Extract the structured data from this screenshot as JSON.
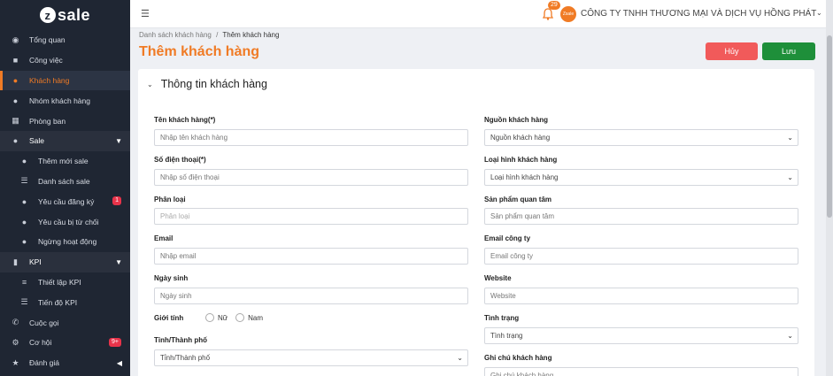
{
  "app": {
    "logo_letter": "z",
    "logo_text": "sale"
  },
  "sidebar": {
    "items": [
      {
        "label": "Tổng quan",
        "icon": "dashboard-icon"
      },
      {
        "label": "Công việc",
        "icon": "briefcase-icon"
      },
      {
        "label": "Khách hàng",
        "icon": "user-icon",
        "active": true
      },
      {
        "label": "Nhóm khách hàng",
        "icon": "users-icon"
      },
      {
        "label": "Phòng ban",
        "icon": "building-icon"
      },
      {
        "label": "Sale",
        "icon": "user-tie-icon",
        "group": true
      },
      {
        "label": "Thêm mới sale",
        "icon": "user-plus-icon",
        "sub": true
      },
      {
        "label": "Danh sách sale",
        "icon": "list-icon",
        "sub": true
      },
      {
        "label": "Yêu cầu đăng ký",
        "icon": "user-plus-icon",
        "sub": true,
        "badge": "1"
      },
      {
        "label": "Yêu cầu bị từ chối",
        "icon": "user-times-icon",
        "sub": true
      },
      {
        "label": "Ngừng hoạt động",
        "icon": "user-slash-icon",
        "sub": true
      },
      {
        "label": "KPI",
        "icon": "chart-icon",
        "group": true
      },
      {
        "label": "Thiết lập KPI",
        "icon": "sliders-icon",
        "sub": true
      },
      {
        "label": "Tiến độ KPI",
        "icon": "list-icon",
        "sub": true
      },
      {
        "label": "Cuộc gọi",
        "icon": "phone-icon"
      },
      {
        "label": "Cơ hội",
        "icon": "gear-icon",
        "badge": "9+"
      },
      {
        "label": "Đánh giá",
        "icon": "star-icon"
      }
    ]
  },
  "header": {
    "notification_count": "29",
    "company_logo_text": "Zsale",
    "company_name": "CÔNG TY TNHH THƯƠNG MẠI VÀ DỊCH VỤ HỒNG PHÁT"
  },
  "breadcrumb": {
    "parent": "Danh sách khách hàng",
    "separator": "/",
    "current": "Thêm khách hàng"
  },
  "page": {
    "title": "Thêm khách hàng",
    "cancel_label": "Hủy",
    "save_label": "Lưu"
  },
  "form": {
    "section_title": "Thông tin khách hàng",
    "left": [
      {
        "label": "Tên khách hàng(*)",
        "placeholder": "Nhập tên khách hàng"
      },
      {
        "label": "Số điện thoại(*)",
        "placeholder": "Nhập số điện thoại"
      },
      {
        "label": "Phân loại",
        "placeholder": "Phân loại"
      },
      {
        "label": "Email",
        "placeholder": "Nhập email"
      },
      {
        "label": "Ngày sinh",
        "placeholder": "Ngày sinh"
      },
      {
        "label": "Tỉnh/Thành phố",
        "placeholder": "Tỉnh/Thành phố",
        "select": true
      }
    ],
    "gender": {
      "label": "Giới tính",
      "options": [
        "Nữ",
        "Nam"
      ]
    },
    "right": [
      {
        "label": "Nguồn khách hàng",
        "placeholder": "Nguồn khách hàng",
        "select": true
      },
      {
        "label": "Loại hình khách hàng",
        "placeholder": "Loại hình khách hàng",
        "select": true
      },
      {
        "label": "Sản phẩm quan tâm",
        "placeholder": "Sản phẩm quan tâm"
      },
      {
        "label": "Email công ty",
        "placeholder": "Email công ty"
      },
      {
        "label": "Website",
        "placeholder": "Website"
      },
      {
        "label": "Tình trạng",
        "placeholder": "Tình trạng",
        "select": true
      },
      {
        "label": "Ghi chú khách hàng",
        "placeholder": "Ghi chú khách hàng"
      }
    ]
  },
  "colors": {
    "accent": "#f07b25",
    "sidebar_bg": "#1f2633",
    "cancel": "#f15a5a",
    "save": "#1e8f3a"
  }
}
